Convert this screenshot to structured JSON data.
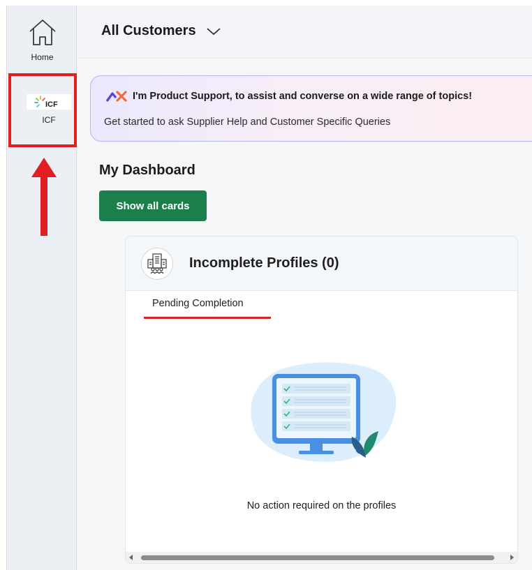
{
  "sidebar": {
    "home": {
      "label": "Home",
      "icon": "home-icon"
    },
    "icf": {
      "label": "ICF",
      "logo_text": "ICF",
      "icon": "icf-logo"
    }
  },
  "header": {
    "title": "All Customers",
    "dropdown_icon": "chevron-down-icon"
  },
  "banner": {
    "title": "I'm Product Support, to assist and converse on a wide range of topics!",
    "subtitle": "Get started to ask Supplier Help and Customer Specific Queries",
    "icon": "product-support-logo-icon"
  },
  "dashboard": {
    "title": "My Dashboard",
    "show_all_label": "Show all cards"
  },
  "card": {
    "title": "Incomplete Profiles (0)",
    "icon": "building-people-icon",
    "tabs": [
      {
        "label": "Pending Completion",
        "active": true
      }
    ],
    "empty_message": "No action required on the profiles"
  },
  "colors": {
    "accent_green": "#1a7f4b",
    "highlight_red": "#e02020",
    "tab_underline": "#d1252c",
    "banner_border": "#b8b3f3"
  }
}
